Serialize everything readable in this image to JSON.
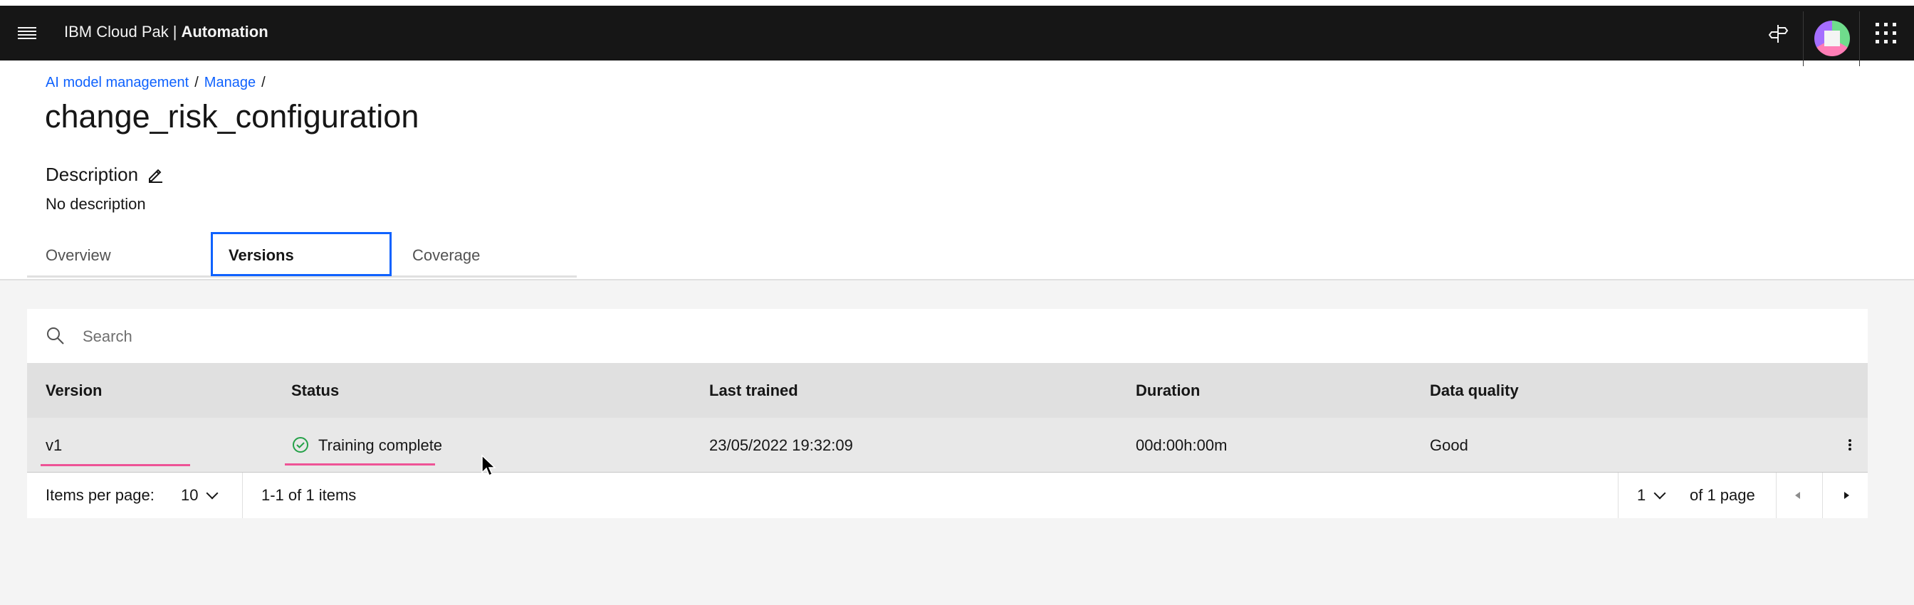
{
  "header": {
    "brand_prefix": "IBM Cloud Pak",
    "brand_separator": "|",
    "brand_product": "Automation",
    "icons": [
      "menu-icon",
      "signpost-icon",
      "avatar",
      "app-switcher-icon"
    ]
  },
  "breadcrumb": {
    "items": [
      "AI model management",
      "Manage"
    ],
    "separator": "/"
  },
  "page": {
    "title": "change_risk_configuration",
    "description_label": "Description",
    "description_value": "No description"
  },
  "tabs": [
    {
      "label": "Overview",
      "active": false
    },
    {
      "label": "Versions",
      "active": true
    },
    {
      "label": "Coverage",
      "active": false
    }
  ],
  "search": {
    "placeholder": "Search"
  },
  "table": {
    "columns": [
      "Version",
      "Status",
      "Last trained",
      "Duration",
      "Data quality"
    ],
    "rows": [
      {
        "version": "v1",
        "status": "Training complete",
        "last_trained": "23/05/2022 19:32:09",
        "duration": "00d:00h:00m",
        "data_quality": "Good"
      }
    ]
  },
  "pagination": {
    "items_per_page_label": "Items per page:",
    "items_per_page": "10",
    "range_text": "1-1 of 1 items",
    "current_page": "1",
    "total_pages_text": "of 1 page"
  },
  "colors": {
    "header_bg": "#161616",
    "link": "#0f62fe",
    "active_tab_border": "#0f62fe",
    "annotation_underline": "#ee5396",
    "success": "#24a148"
  }
}
